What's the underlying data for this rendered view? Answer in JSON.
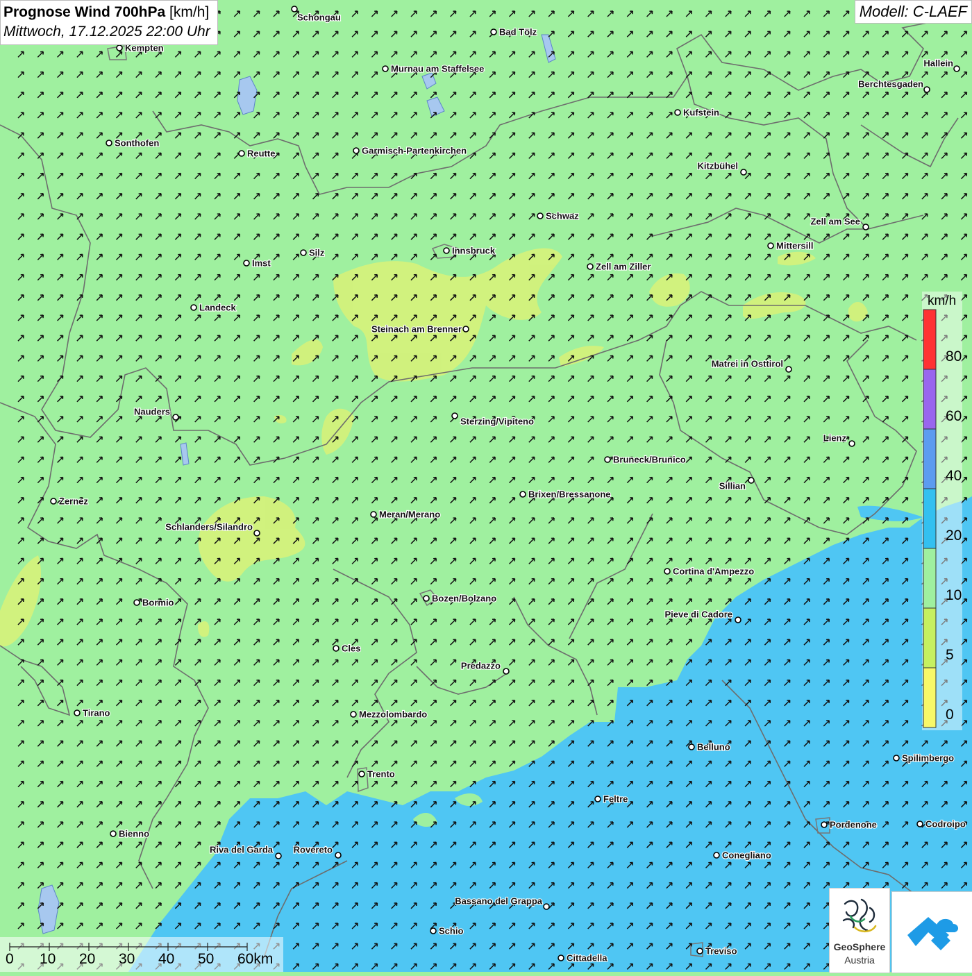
{
  "header": {
    "title_bold": "Prognose Wind 700hPa",
    "title_unit": "[km/h]",
    "datetime": "Mittwoch, 17.12.2025 22:00 Uhr",
    "model": "Modell: C-LAEF"
  },
  "legend": {
    "unit": "km/h",
    "ticks": [
      "80",
      "60",
      "40",
      "20",
      "10",
      "5",
      "0"
    ],
    "colors": [
      "#ff3333",
      "#9966ee",
      "#5c9cf0",
      "#33c0f0",
      "#9ff09f",
      "#c6f060",
      "#f8f868"
    ]
  },
  "map_colors": {
    "base": "#9ff09f",
    "light_wind": "#d6f27a",
    "strong_wind": "#4fc6f3",
    "arrow": "#111111",
    "border": "#6d6d6d"
  },
  "places": [
    {
      "name": "Schongau"
    },
    {
      "name": "Bad Tölz"
    },
    {
      "name": "Kempten"
    },
    {
      "name": "Murnau am Staffelsee"
    },
    {
      "name": "Hallein"
    },
    {
      "name": "Berchtesgaden"
    },
    {
      "name": "Kufstein"
    },
    {
      "name": "Sonthofen"
    },
    {
      "name": "Reutte"
    },
    {
      "name": "Garmisch-Partenkirchen"
    },
    {
      "name": "Kitzbühel"
    },
    {
      "name": "Schwaz"
    },
    {
      "name": "Zell am See"
    },
    {
      "name": "Mittersill"
    },
    {
      "name": "Innsbruck"
    },
    {
      "name": "Silz"
    },
    {
      "name": "Imst"
    },
    {
      "name": "Zell am Ziller"
    },
    {
      "name": "Landeck"
    },
    {
      "name": "Steinach am Brenner"
    },
    {
      "name": "Matrei in Osttirol"
    },
    {
      "name": "Nauders"
    },
    {
      "name": "Sterzing/Vipiteno"
    },
    {
      "name": "Lienz"
    },
    {
      "name": "Bruneck/Brunico"
    },
    {
      "name": "Sillian"
    },
    {
      "name": "Zernez"
    },
    {
      "name": "Brixen/Bressanone"
    },
    {
      "name": "Meran/Merano"
    },
    {
      "name": "Schlanders/Silandro"
    },
    {
      "name": "Cortina d'Ampezzo"
    },
    {
      "name": "Bozen/Bolzano"
    },
    {
      "name": "Bormio"
    },
    {
      "name": "Pieve di Cadore"
    },
    {
      "name": "Cles"
    },
    {
      "name": "Predazzo"
    },
    {
      "name": "Tirano"
    },
    {
      "name": "Mezzolombardo"
    },
    {
      "name": "Belluno"
    },
    {
      "name": "Spilimbergo"
    },
    {
      "name": "Trento"
    },
    {
      "name": "Feltre"
    },
    {
      "name": "Bienno"
    },
    {
      "name": "Pordenone"
    },
    {
      "name": "Codroipo"
    },
    {
      "name": "Riva del Garda"
    },
    {
      "name": "Rovereto"
    },
    {
      "name": "Conegliano"
    },
    {
      "name": "Bassano del Grappa"
    },
    {
      "name": "Schio"
    },
    {
      "name": "Treviso"
    },
    {
      "name": "Cittadella"
    }
  ],
  "scale_bar": {
    "labels": [
      "0",
      "10",
      "20",
      "30",
      "40",
      "50",
      "60km"
    ]
  },
  "logos": {
    "geosphere_line1": "GeoSphere",
    "geosphere_line2": "Austria"
  }
}
